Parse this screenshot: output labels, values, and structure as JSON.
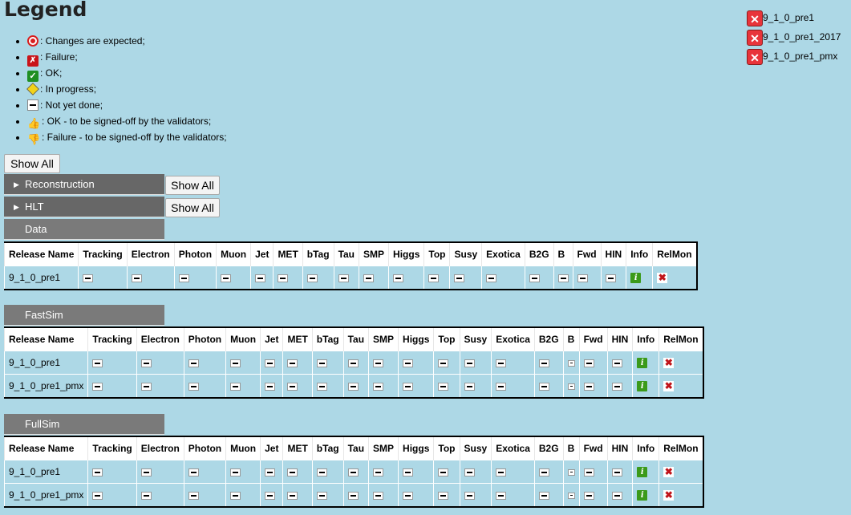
{
  "legend": {
    "title": "Legend",
    "items": [
      {
        "icon": "target-icon",
        "text": ": Changes are expected;"
      },
      {
        "icon": "failure-icon",
        "text": ": Failure;"
      },
      {
        "icon": "ok-icon",
        "text": ": OK;"
      },
      {
        "icon": "in-progress-icon",
        "text": ": In progress;"
      },
      {
        "icon": "not-yet-done-icon",
        "text": ": Not yet done;"
      },
      {
        "icon": "thumbs-up-icon",
        "text": ": OK - to be signed-off by the validators;"
      },
      {
        "icon": "thumbs-down-icon",
        "text": ": Failure - to be signed-off by the validators;"
      }
    ]
  },
  "buttons": {
    "show_all": "Show All"
  },
  "sections": {
    "reconstruction": "Reconstruction",
    "hlt": "HLT",
    "data": "Data",
    "fastsim": "FastSim",
    "fullsim": "FullSim"
  },
  "releases": [
    "9_1_0_pre1",
    "9_1_0_pre1_2017",
    "9_1_0_pre1_pmx"
  ],
  "columns": [
    "Release Name",
    "Tracking",
    "Electron",
    "Photon",
    "Muon",
    "Jet",
    "MET",
    "bTag",
    "Tau",
    "SMP",
    "Higgs",
    "Top",
    "Susy",
    "Exotica",
    "B2G",
    "B",
    "Fwd",
    "HIN",
    "Info",
    "RelMon"
  ],
  "tables": {
    "data": {
      "rows": [
        "9_1_0_pre1"
      ]
    },
    "fastsim": {
      "rows": [
        "9_1_0_pre1",
        "9_1_0_pre1_pmx"
      ]
    },
    "fullsim": {
      "rows": [
        "9_1_0_pre1",
        "9_1_0_pre1_pmx"
      ]
    }
  }
}
